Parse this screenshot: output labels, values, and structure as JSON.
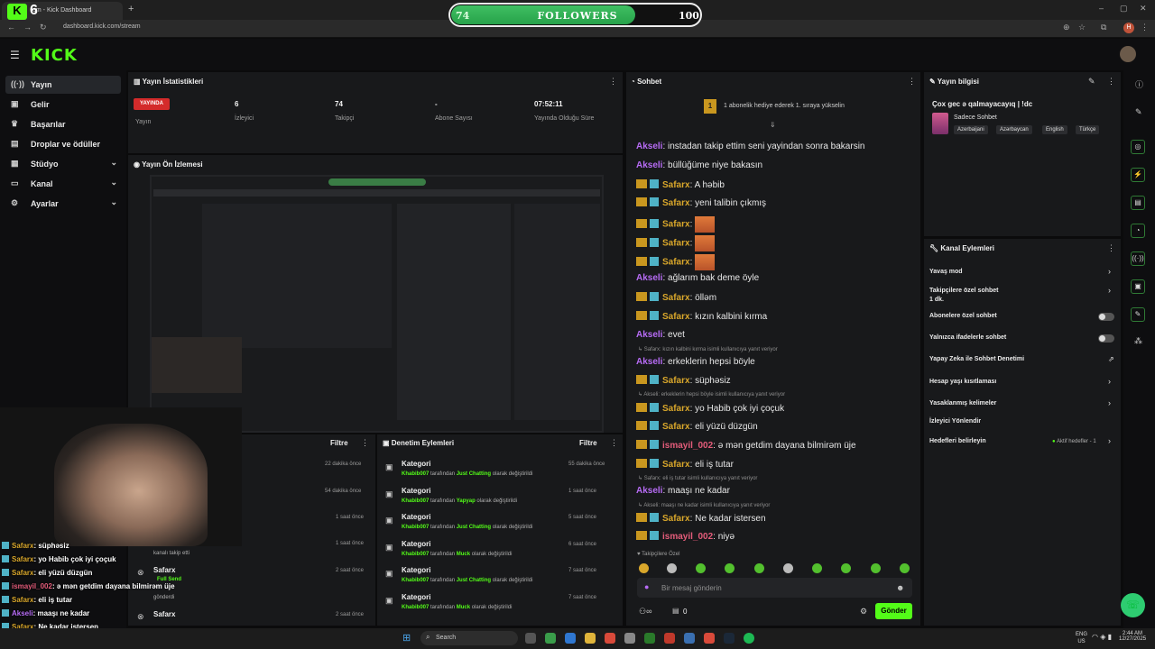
{
  "overlay": {
    "k_count": "6",
    "followers_current": "74",
    "followers_label": "FOLLOWERS",
    "followers_goal": "100",
    "followers_progress": 0.74
  },
  "browser": {
    "tab_title": "om - Kick Dashboard",
    "url": "dashboard.kick.com/stream"
  },
  "brand": {
    "logo": "KICK"
  },
  "sidebar": {
    "items": [
      {
        "label": "Yayın",
        "icon": "broadcast-icon",
        "expand": false
      },
      {
        "label": "Gelir",
        "icon": "money-icon",
        "expand": false
      },
      {
        "label": "Başarılar",
        "icon": "trophy-icon",
        "expand": false
      },
      {
        "label": "Droplar ve ödüller",
        "icon": "gift-icon",
        "expand": false
      },
      {
        "label": "Stüdyo",
        "icon": "studio-icon",
        "expand": true
      },
      {
        "label": "Kanal",
        "icon": "channel-icon",
        "expand": true
      },
      {
        "label": "Ayarlar",
        "icon": "gear-icon",
        "expand": true
      }
    ]
  },
  "stats": {
    "title": "Yayın İstatistikleri",
    "live_badge": "YAYINDA",
    "live_label": "Yayın",
    "viewers": {
      "value": "6",
      "label": "İzleyici"
    },
    "followers": {
      "value": "74",
      "label": "Takipçi"
    },
    "subs": {
      "value": "-",
      "label": "Abone Sayısı"
    },
    "uptime": {
      "value": "07:52:11",
      "label": "Yayında Olduğu Süre"
    }
  },
  "preview": {
    "title": "Yayın Ön İzlemesi"
  },
  "activity": {
    "filter": "Filtre",
    "times": [
      "22 dakika önce",
      "54 dakika önce",
      "1 saat önce",
      "1 saat önce",
      "2 saat önce",
      "2 saat önce"
    ],
    "row5_user": "Safarx",
    "row5_badge": "Full Send",
    "row5_action": "gönderdi",
    "row6_user": "Safarx",
    "row4_action": "kanalı takip etti"
  },
  "mod": {
    "title": "Denetim Eylemleri",
    "filter": "Filtre",
    "rows": [
      {
        "title": "Kategori",
        "user": "Khabib007",
        "mid": "tarafından",
        "cat": "Just Chatting",
        "end": "olarak değiştirildi",
        "time": "55 dakika önce"
      },
      {
        "title": "Kategori",
        "user": "Khabib007",
        "mid": "tarafından",
        "cat": "Yapyap",
        "end": "olarak değiştirildi",
        "time": "1 saat önce"
      },
      {
        "title": "Kategori",
        "user": "Khabib007",
        "mid": "tarafından",
        "cat": "Just Chatting",
        "end": "olarak değiştirildi",
        "time": "5 saat önce"
      },
      {
        "title": "Kategori",
        "user": "Khabib007",
        "mid": "tarafından",
        "cat": "Muck",
        "end": "olarak değiştirildi",
        "time": "6 saat önce"
      },
      {
        "title": "Kategori",
        "user": "Khabib007",
        "mid": "tarafından",
        "cat": "Just Chatting",
        "end": "olarak değiştirildi",
        "time": "7 saat önce"
      },
      {
        "title": "Kategori",
        "user": "Khabib007",
        "mid": "tarafından",
        "cat": "Muck",
        "end": "olarak değiştirildi",
        "time": "7 saat önce"
      }
    ]
  },
  "chat": {
    "title": "Sohbet",
    "pinned": "1 abonelik hediye ederek 1. sıraya yükselin",
    "lines": [
      {
        "user": "Akseli",
        "cls": "ak",
        "text": ": instadan takip ettim seni yayindan sonra bakarsin",
        "badges": false
      },
      {
        "user": "Akseli",
        "cls": "ak",
        "text": ": büllüğüme niye bakasın",
        "badges": false
      },
      {
        "user": "Safarx",
        "cls": "sf",
        "text": ": A həbib",
        "badges": true
      },
      {
        "user": "Safarx",
        "cls": "sf",
        "text": ": yeni talibin çıkmış",
        "badges": true
      },
      {
        "user": "Safarx",
        "cls": "sf",
        "text": ":",
        "badges": true,
        "emote": true
      },
      {
        "user": "Safarx",
        "cls": "sf",
        "text": ":",
        "badges": true,
        "emote": true
      },
      {
        "user": "Safarx",
        "cls": "sf",
        "text": ":",
        "badges": true,
        "emote": true
      },
      {
        "user": "Akseli",
        "cls": "ak",
        "text": ": ağlarım bak deme öyle",
        "badges": false
      },
      {
        "user": "Safarx",
        "cls": "sf",
        "text": ": ölləm",
        "badges": true
      },
      {
        "user": "Safarx",
        "cls": "sf",
        "text": ": kızın kalbini kırma",
        "badges": true
      },
      {
        "user": "Akseli",
        "cls": "ak",
        "text": ": evet",
        "badges": false
      },
      {
        "user": "Akseli",
        "cls": "ak",
        "text": ": erkeklerin hepsi böyle",
        "badges": false
      },
      {
        "user": "Safarx",
        "cls": "sf",
        "text": ": süphəsiz",
        "badges": true
      },
      {
        "user": "Safarx",
        "cls": "sf",
        "text": ": yo Habib çok iyi çoçuk",
        "badges": true
      },
      {
        "user": "Safarx",
        "cls": "sf",
        "text": ": eli yüzü düzgün",
        "badges": true
      },
      {
        "user": "ismayil_002",
        "cls": "is",
        "text": ": ə mən getdim dayana bilmirəm üje",
        "badges": true
      },
      {
        "user": "Safarx",
        "cls": "sf",
        "text": ": eli iş tutar",
        "badges": true
      },
      {
        "user": "Akseli",
        "cls": "ak",
        "text": ": maaşı ne kadar",
        "badges": false
      },
      {
        "user": "Safarx",
        "cls": "sf",
        "text": ": Ne kadar istersen",
        "badges": true
      },
      {
        "user": "ismayil_002",
        "cls": "is",
        "text": ": niyə",
        "badges": true
      }
    ],
    "replies": [
      "Safarx: kızın kalbini kırma isimli kullanıcıya yanıt veriyor",
      "Akseli: erkeklerin hepsi böyle isimli kullanıcıya yanıt veriyor",
      "Safarx: eli iş tutar isimli kullanıcıya yanıt veriyor",
      "Akseli: maaşı ne kadar isimli kullanıcıya yanıt veriyor"
    ],
    "followers_only": "Takipçilere Özel",
    "input_placeholder": "Bir mesaj gönderin",
    "send": "Gönder",
    "points": "0"
  },
  "stream_info": {
    "title": "Yayın bilgisi",
    "stream_title": "Çox gec ə qalmayacayıq | !dc",
    "category": "Sadece Sohbet",
    "tags": [
      "Azerbaijani",
      "Azərbaycan",
      "English",
      "Türkçe"
    ]
  },
  "channel_actions": {
    "title": "Kanal Eylemleri",
    "items": [
      {
        "label": "Yavaş mod",
        "type": "chevron"
      },
      {
        "label": "Takipçilere özel sohbet",
        "sub": "1 dk.",
        "type": "chevron"
      },
      {
        "label": "Abonelere özel sohbet",
        "type": "toggle"
      },
      {
        "label": "Yalnızca ifadelerle sohbet",
        "type": "toggle"
      },
      {
        "label": "Yapay Zeka ile Sohbet Denetimi",
        "type": "ext"
      },
      {
        "label": "Hesap yaşı kısıtlaması",
        "type": "chevron"
      },
      {
        "label": "Yasaklanmış kelimeler",
        "type": "chevron"
      },
      {
        "label": "İzleyici Yönlendir",
        "type": "none"
      },
      {
        "label": "Hedefleri belirleyin",
        "type": "chevron",
        "note": "Aktif hedefler - 1"
      }
    ]
  },
  "overlay_chat": [
    {
      "user": "Safarx",
      "text": ": süphəsiz",
      "color": "#d9a72b"
    },
    {
      "user": "Safarx",
      "text": ": yo Habib çok iyi çoçuk",
      "color": "#d9a72b"
    },
    {
      "user": "Safarx",
      "text": ": eli yüzü düzgün",
      "color": "#d9a72b"
    },
    {
      "user": "ismayil_002",
      "text": ": ə mən getdim dayana bilmirəm üje",
      "color": "#e45c7a"
    },
    {
      "user": "Safarx",
      "text": ": eli iş tutar",
      "color": "#d9a72b"
    },
    {
      "user": "Akseli",
      "text": ": maaşı ne kadar",
      "color": "#b76cf5"
    },
    {
      "user": "Safarx",
      "text": ": Ne kadar istersen",
      "color": "#d9a72b"
    },
    {
      "user": "ismayil_002",
      "text": ": niyə",
      "color": "#e45c7a"
    }
  ],
  "taskbar": {
    "search": "Search",
    "lang": "ENG",
    "region": "US",
    "time": "2:44 AM",
    "date": "12/27/2025"
  },
  "colors": {
    "accent": "#53fc18",
    "panel": "#18191b",
    "live": "#d42b2b"
  }
}
